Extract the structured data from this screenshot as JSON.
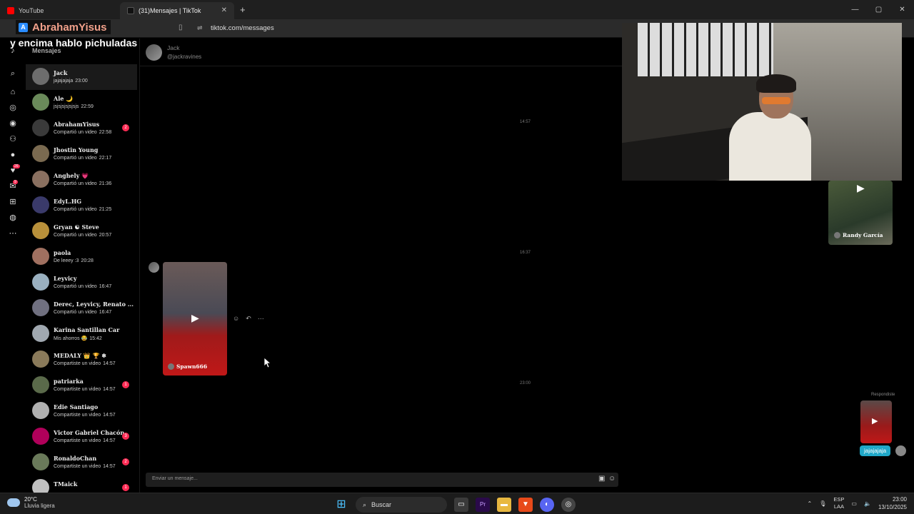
{
  "browser": {
    "tabs": [
      {
        "label": "YouTube",
        "color": "#ff0000"
      },
      {
        "label": "(31)Mensajes | TikTok",
        "color": "#111111"
      }
    ],
    "new_tab": "+",
    "url": "tiktok.com/messages",
    "window_controls": [
      "—",
      "▢",
      "✕"
    ]
  },
  "overlay": {
    "streamer_name": "AbrahamYisus",
    "caption": "y encima hablo pichuladas"
  },
  "rail": {
    "icons": [
      "tiktok-logo-icon",
      "search-icon",
      "home-icon",
      "explore-icon",
      "live-icon",
      "following-icon",
      "profile-icon",
      "activity-icon",
      "messages-icon",
      "upload-icon",
      "globe-icon",
      "more-icon"
    ],
    "activity_badge": "26",
    "messages_badge": "9"
  },
  "conversations": {
    "title": "Mensajes",
    "items": [
      {
        "name": "Jack",
        "preview": "jajajajaja",
        "time": "23:00",
        "unread": "",
        "color": "#6d6d6d"
      },
      {
        "name": "Ale 🌙",
        "preview": "jsjsjsjsjsjsjs",
        "time": "22:59",
        "unread": "",
        "color": "#6a8a5a"
      },
      {
        "name": "AbrahamYisus",
        "preview": "Compartió un video",
        "time": "22:58",
        "unread": "2",
        "color": "#3a3a3a"
      },
      {
        "name": "Jhostin Young",
        "preview": "Compartió un video",
        "time": "22:17",
        "unread": "",
        "color": "#7a6a50"
      },
      {
        "name": "Anghely 💗",
        "preview": "Compartió un video",
        "time": "21:36",
        "unread": "",
        "color": "#8a7060"
      },
      {
        "name": "EdyL.HG",
        "preview": "Compartió un video",
        "time": "21:25",
        "unread": "",
        "color": "#3a3a6a"
      },
      {
        "name": "Gryan ☯ Steve",
        "preview": "Compartió un video",
        "time": "20:57",
        "unread": "",
        "color": "#b8903a"
      },
      {
        "name": "paola",
        "preview": "De leeey :3",
        "time": "20:28",
        "unread": "",
        "color": "#a07060"
      },
      {
        "name": "Leyvicy",
        "preview": "Compartió un video",
        "time": "16:47",
        "unread": "",
        "color": "#9ab0c0"
      },
      {
        "name": "Derec, Leyvicy, Renato ...",
        "preview": "Compartió un video",
        "time": "16:47",
        "unread": "",
        "color": "#707080"
      },
      {
        "name": "Karina Santillan Car",
        "preview": "Mis ahorros 😂",
        "time": "15:42",
        "unread": "",
        "color": "#a0a8b0"
      },
      {
        "name": "MEDALY 👑 🏆 ❄",
        "preview": "Compartiste un video",
        "time": "14:57",
        "unread": "",
        "color": "#8a7a5a"
      },
      {
        "name": "patriarka",
        "preview": "Compartiste un video",
        "time": "14:57",
        "unread": "1",
        "color": "#5a6a4a"
      },
      {
        "name": "Edie Santiago",
        "preview": "Compartiste un video",
        "time": "14:57",
        "unread": "",
        "color": "#b0b0b0"
      },
      {
        "name": "Victor Gabriel Chacón",
        "preview": "Compartiste un video",
        "time": "14:57",
        "unread": "3",
        "color": "#b0005a"
      },
      {
        "name": "RonaldoChan",
        "preview": "Compartiste un video",
        "time": "14:57",
        "unread": "2",
        "color": "#6a7a5a"
      },
      {
        "name": "TMaick",
        "preview": "",
        "time": "",
        "unread": "1",
        "color": "#c0c0c0"
      }
    ]
  },
  "chat": {
    "contact_name": "Jack",
    "contact_handle": "@jackravines",
    "timestamps": [
      "14:57",
      "16:37",
      "23:00"
    ],
    "shared_video_author": "Spawn666",
    "top_video_author": "Randy García",
    "replied_label": "Respondiste",
    "sent_text": "jajajajaja",
    "input_placeholder": "Enviar un mensaje..."
  },
  "taskbar": {
    "temperature": "20°C",
    "weather": "Lluvia ligera",
    "search_label": "Buscar",
    "lang1": "ESP",
    "lang2": "LAA",
    "time": "23:00",
    "date": "13/10/2025"
  }
}
